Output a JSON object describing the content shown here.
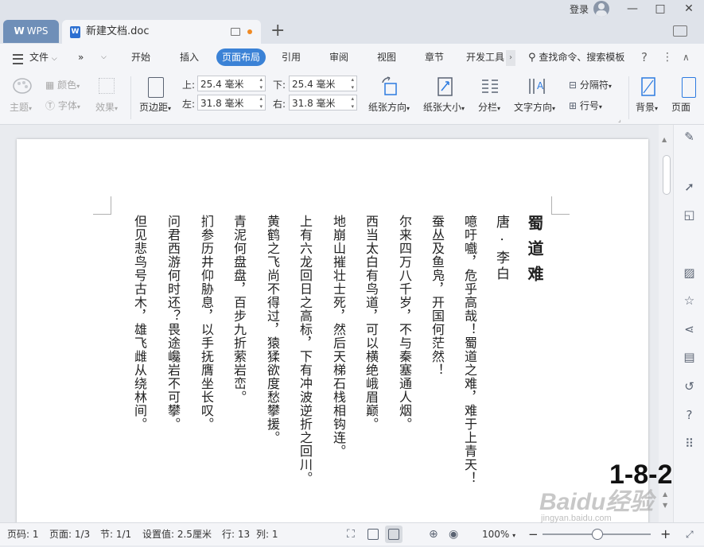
{
  "titlebar": {
    "wps_tab": "WPS",
    "doc_tab_title": "新建文档.doc",
    "new_tab": "+",
    "login": "登录",
    "minimize": "—",
    "maximize": "□",
    "close": "✕"
  },
  "menubar": {
    "file": "文件",
    "more": "»",
    "tabs": [
      "开始",
      "插入",
      "页面布局",
      "引用",
      "审阅",
      "视图",
      "章节",
      "开发工具"
    ],
    "active_tab": "页面布局",
    "search": "查找命令、搜索模板",
    "help": "?",
    "options": "⋮",
    "collapse": "∧"
  },
  "ribbon": {
    "theme": "主题",
    "colors": "颜色",
    "fonts": "字体",
    "effects": "效果",
    "margins": "页边距",
    "top_label": "上:",
    "top_value": "25.4 毫米",
    "bottom_label": "下:",
    "bottom_value": "25.4 毫米",
    "left_label": "左:",
    "left_value": "31.8 毫米",
    "right_label": "右:",
    "right_value": "31.8 毫米",
    "orientation": "纸张方向",
    "size": "纸张大小",
    "columns": "分栏",
    "text_direction": "文字方向",
    "separator": "分隔符",
    "line_numbers": "行号",
    "background": "背景",
    "page_border": "页面"
  },
  "document": {
    "title": "蜀道难",
    "author": "唐 · 李白",
    "lines": [
      "噫吁嚱，危乎高哉！蜀道之难，难于上青天！",
      "蚕丛及鱼凫，开国何茫然！",
      "尔来四万八千岁，不与秦塞通人烟。",
      "西当太白有鸟道，可以横绝峨眉巅。",
      "地崩山摧壮士死，然后天梯石栈相钩连。",
      "上有六龙回日之高标，下有冲波逆折之回川。",
      "黄鹤之飞尚不得过，猿猱欲度愁攀援。",
      "青泥何盘盘，百步九折萦岩峦。",
      "扪参历井仰胁息，以手抚膺坐长叹。",
      "问君西游何时还？畏途巉岩不可攀。",
      "但见悲鸟号古木，雄飞雌从绕林间。"
    ]
  },
  "statusbar": {
    "page_no": "页码: 1",
    "pages": "页面: 1/3",
    "section": "节: 1/1",
    "position": "设置值: 2.5厘米",
    "row": "行: 13",
    "col": "列: 1",
    "zoom": "100%",
    "zoom_out": "−",
    "zoom_in": "+",
    "zoom_level": 0.5
  },
  "watermark": {
    "label": "1-8-2",
    "logo": "Baidu经验",
    "site": "jingyan.baidu.com"
  },
  "colors": {
    "accent": "#3b82d6",
    "wps_tab": "#6f8fb8",
    "doc_icon": "#2c6fd1",
    "unsaved_dot": "#f08a24"
  }
}
